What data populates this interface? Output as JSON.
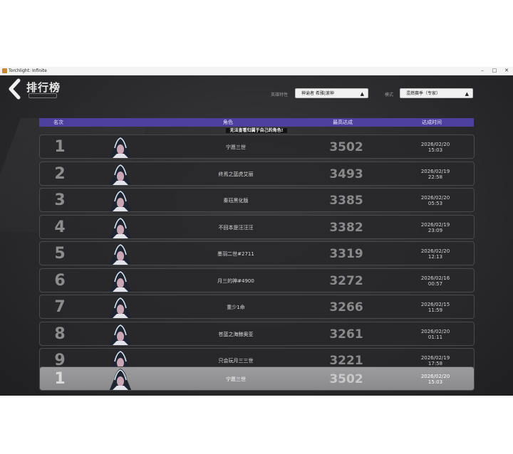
{
  "window": {
    "title": "Torchlight: Infinite",
    "minimize": "–",
    "maximize": "□",
    "close": "✕"
  },
  "page": {
    "title": "排行榜"
  },
  "filters": {
    "hero_label": "英雄特性",
    "hero_value": "神谕者 希雅|滚神",
    "mode_label": "模式",
    "mode_value": "混燃赛季（专家）"
  },
  "table": {
    "headers": {
      "rank": "名次",
      "role": "角色",
      "score": "最高达成",
      "time": "达成时间"
    },
    "notice": "无法查看归属于自己的角色!",
    "rows": [
      {
        "rank": "1",
        "name": "宁愿三世",
        "score": "3502",
        "date": "2026/02/20",
        "time": "15:03"
      },
      {
        "rank": "2",
        "name": "终焉之蓝虎艾丽",
        "score": "3493",
        "date": "2026/02/19",
        "time": "22:58"
      },
      {
        "rank": "3",
        "name": "秦珏黑化版",
        "score": "3385",
        "date": "2026/02/20",
        "time": "05:53"
      },
      {
        "rank": "4",
        "name": "不回本是汪汪汪",
        "score": "3382",
        "date": "2026/02/19",
        "time": "23:09"
      },
      {
        "rank": "5",
        "name": "墨羽二世#2711",
        "score": "3319",
        "date": "2026/02/20",
        "time": "12:13"
      },
      {
        "rank": "6",
        "name": "月三的神#4900",
        "score": "3272",
        "date": "2026/02/16",
        "time": "00:57"
      },
      {
        "rank": "7",
        "name": "重少1命",
        "score": "3266",
        "date": "2026/02/15",
        "time": "11:59"
      },
      {
        "rank": "8",
        "name": "苍蓝之海鲸奥亚",
        "score": "3261",
        "date": "2026/02/20",
        "time": "01:11"
      },
      {
        "rank": "9",
        "name": "只会玩月三三世",
        "score": "3221",
        "date": "2026/02/19",
        "time": "17:58"
      }
    ],
    "self_row": {
      "rank": "1",
      "name": "宁愿三世",
      "score": "3502",
      "date": "2026/02/20",
      "time": "15:03"
    }
  },
  "colors": {
    "header_bar": "#4d3f9e",
    "self_row": "#9c9c9e"
  }
}
